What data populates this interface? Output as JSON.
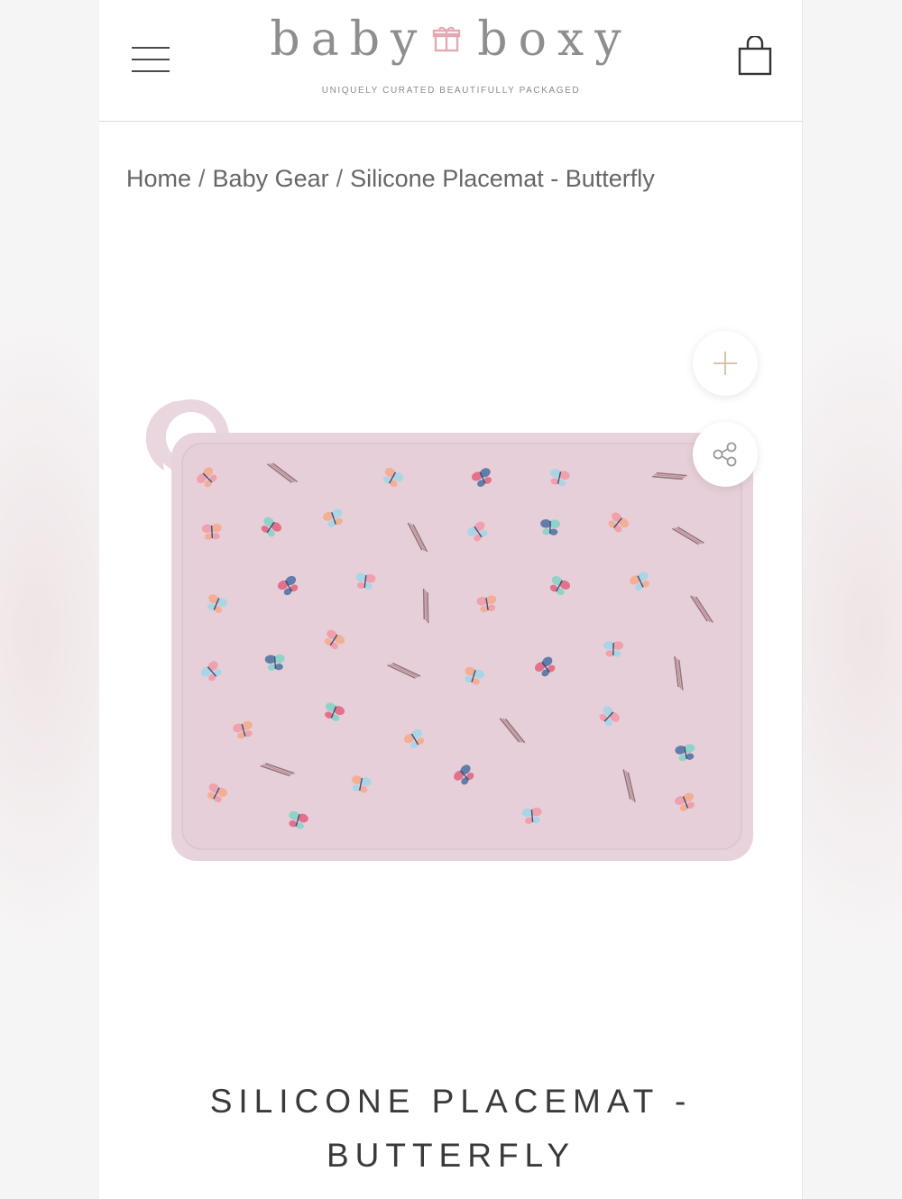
{
  "header": {
    "logo_left": "baby",
    "logo_right": "boxy",
    "tagline": "UNIQUELY CURATED BEAUTIFULLY PACKAGED",
    "menu_icon": "hamburger-menu-icon",
    "cart_icon": "shopping-bag-icon",
    "logo_icon": "gift-box-icon",
    "accent_color": "#e6a9b4"
  },
  "breadcrumb": {
    "items": [
      "Home",
      "Baby Gear",
      "Silicone Placemat - Butterfly"
    ],
    "separator": "/"
  },
  "gallery": {
    "zoom_icon": "plus-icon",
    "share_icon": "share-icon",
    "placemat_color": "#e8d3dc"
  },
  "product": {
    "title_line1": "SILICONE PLACEMAT -",
    "title_line2": "BUTTERFLY"
  }
}
